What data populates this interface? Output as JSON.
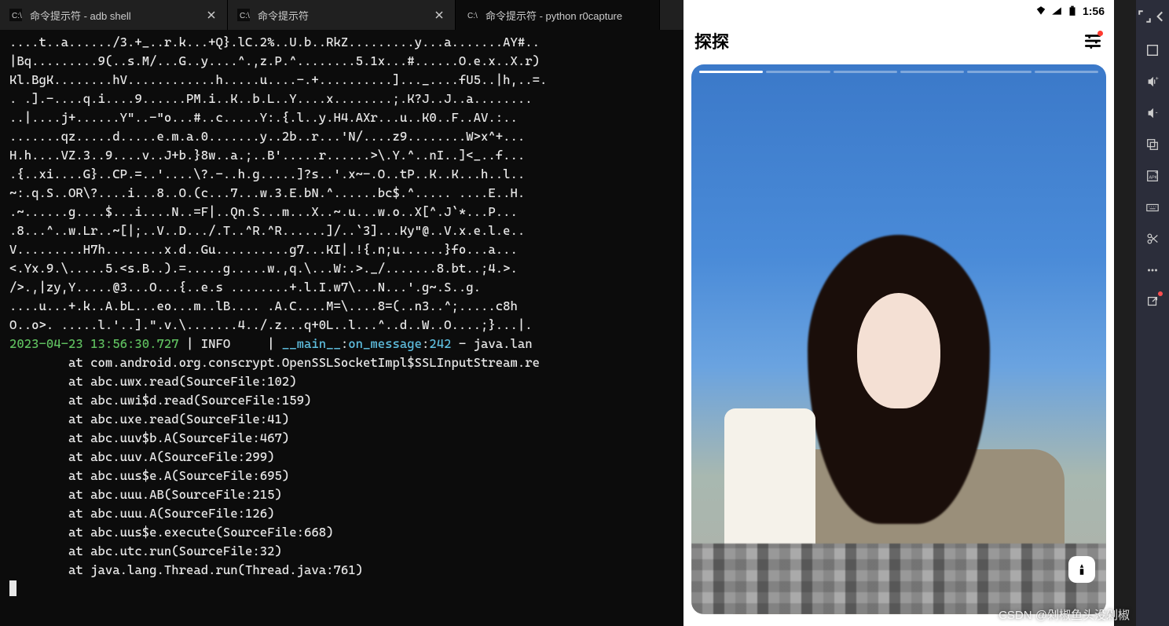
{
  "tabs": [
    {
      "title": "命令提示符 - adb  shell"
    },
    {
      "title": "命令提示符"
    },
    {
      "title": "命令提示符 - python  r0capture"
    }
  ],
  "hexdump": "....t..a....../3.+_..r.k...+Q}.lC.2%..U.b..RkZ.........y...a.......AY#..\n|Bq.........9(..s.M/...G..y....^.,z.P.^........5.1x...#......O.e.x..X.r)\nKl.BgK........hV............h.....u....-.+..........]..._....fU5..|h,..=.\n. .].-....q.i....9......PM.i..K..b.L..Y....x........;.K?J..J..a........\n..|....j+......Y\"..-\"o...#..c.....Y:.{.l..y.H4.AXr...u..K0..F..AV.:..\n.......qz.....d.....e.m.a.0.......y..2b..r...'N/....z9........W>x^+...\nH.h....VZ.3..9....v..J+b.}8w..a.;..B'.....r......>\\.Y.^..nI..]<_..f...\n.{..xi....G}..CP.=..'....\\?.-..h.g.....]?s..'.x~-.O..tP..K..K...h..l..\n~:.q.S..OR\\?....i...8..O.(c...7...w.3.E.bN.^......bc$.^..... ....E..H.\n.~......g....$...i....N..=F|..Qn.S...m...X..~.u...w.o..X[^.J`*...P...\n.8...^..w.Lr..~[|;..V..D.../.T..^R.^R......]/..`3]...Ky\"@..V.x.e.l.e..\nV.........H7h........x.d..Gu..........g7...KI|.!{.n;u......}fo...a...\n<.Yx.9.\\.....5.<s.B..).=.....g.....w.,q.\\...W:.>._/.......8.bt..;4.>.\n/>.,|zy,Y.....@3...O...{..e.s ........+.l.I.w7\\...N...'.g~.S..g.\n....u...+.k..A.bL...eo...m..lB.... .A.C....M=\\....8=(..n3..^;.....c8h\nO..o>. .....l.'..].\".v.\\.......4../.z...q+0L..l...^..d..W..O....;}...|.",
  "log": {
    "timestamp": "2023-04-23 13:56:30.727",
    "level": "INFO",
    "module": "__main__",
    "func": "on_message",
    "lineno": "242",
    "msg": "java.lan"
  },
  "stack": [
    "at com.android.org.conscrypt.OpenSSLSocketImpl$SSLInputStream.re",
    "at abc.uwx.read(SourceFile:102)",
    "at abc.uwi$d.read(SourceFile:159)",
    "at abc.uxe.read(SourceFile:41)",
    "at abc.uuv$b.A(SourceFile:467)",
    "at abc.uuv.A(SourceFile:299)",
    "at abc.uus$e.A(SourceFile:695)",
    "at abc.uuu.AB(SourceFile:215)",
    "at abc.uuu.A(SourceFile:126)",
    "at abc.uus$e.execute(SourceFile:668)",
    "at abc.utc.run(SourceFile:32)",
    "at java.lang.Thread.run(Thread.java:761)"
  ],
  "phone": {
    "status_time": "1:56",
    "app_title": "探探"
  },
  "toolbar": {
    "names": [
      "expand",
      "chevron",
      "volume-up",
      "volume-down",
      "recent",
      "apk",
      "subtitle",
      "scissors",
      "more",
      "share"
    ]
  },
  "watermark": "CSDN @剁椒鱼头没剁椒"
}
